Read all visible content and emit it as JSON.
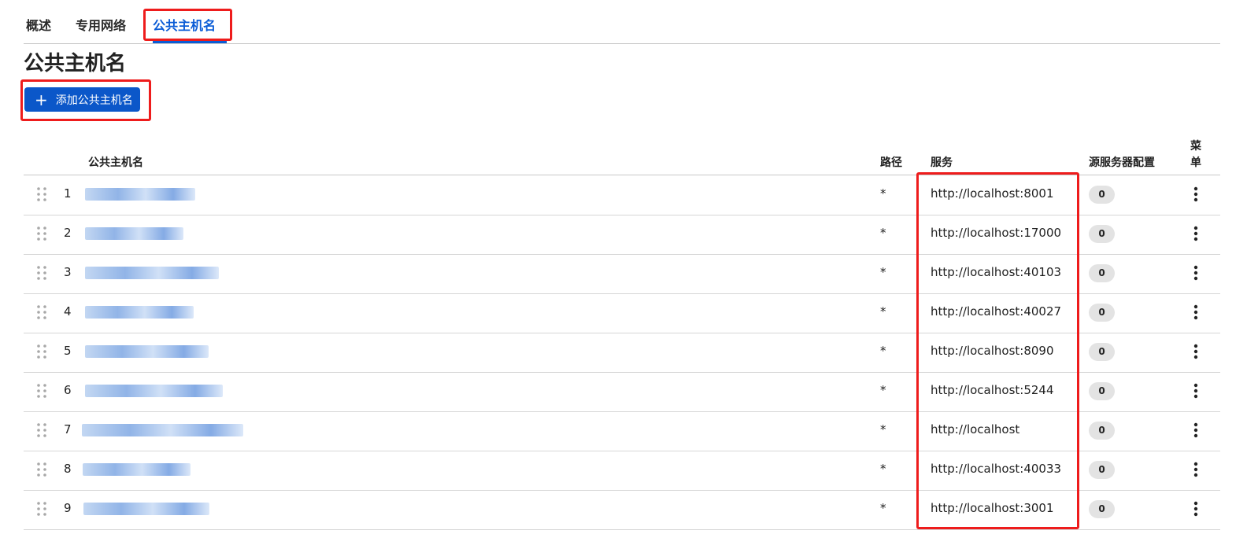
{
  "tabs": [
    {
      "label": "概述"
    },
    {
      "label": "专用网络"
    },
    {
      "label": "公共主机名"
    }
  ],
  "page_title": "公共主机名",
  "add_button": {
    "icon": "plus-icon",
    "label": "添加公共主机名"
  },
  "table": {
    "headers": {
      "hostname": "公共主机名",
      "path": "路径",
      "service": "服务",
      "origin_config": "源服务器配置",
      "menu": "菜单"
    },
    "rows": [
      {
        "index": "1",
        "path": "*",
        "service": "http://localhost:8001",
        "origin_count": "0"
      },
      {
        "index": "2",
        "path": "*",
        "service": "http://localhost:17000",
        "origin_count": "0"
      },
      {
        "index": "3",
        "path": "*",
        "service": "http://localhost:40103",
        "origin_count": "0"
      },
      {
        "index": "4",
        "path": "*",
        "service": "http://localhost:40027",
        "origin_count": "0"
      },
      {
        "index": "5",
        "path": "*",
        "service": "http://localhost:8090",
        "origin_count": "0"
      },
      {
        "index": "6",
        "path": "*",
        "service": "http://localhost:5244",
        "origin_count": "0"
      },
      {
        "index": "7",
        "path": "*",
        "service": "http://localhost",
        "origin_count": "0"
      },
      {
        "index": "8",
        "path": "*",
        "service": "http://localhost:40033",
        "origin_count": "0"
      },
      {
        "index": "9",
        "path": "*",
        "service": "http://localhost:3001",
        "origin_count": "0"
      }
    ]
  },
  "colors": {
    "accent": "#0b5cd6",
    "button_bg": "#0b57c9",
    "annotation": "#ee1c1c",
    "badge_bg": "#e3e3e3"
  }
}
